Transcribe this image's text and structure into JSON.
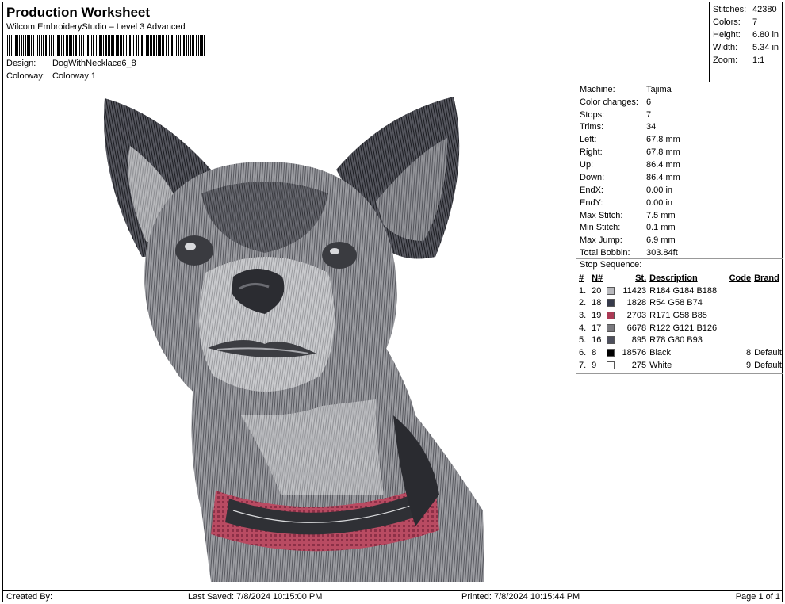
{
  "header": {
    "title": "Production Worksheet",
    "subtitle": "Wilcom EmbroideryStudio – Level 3 Advanced",
    "design_label": "Design:",
    "design_value": "DogWithNecklace6_8",
    "colorway_label": "Colorway:",
    "colorway_value": "Colorway 1"
  },
  "stats": [
    {
      "label": "Stitches:",
      "value": "42380"
    },
    {
      "label": "Colors:",
      "value": "7"
    },
    {
      "label": "Height:",
      "value": "6.80 in"
    },
    {
      "label": "Width:",
      "value": "5.34 in"
    },
    {
      "label": "Zoom:",
      "value": "1:1"
    }
  ],
  "machine_info": [
    {
      "label": "Machine:",
      "value": "Tajima"
    },
    {
      "label": "Color changes:",
      "value": "6"
    },
    {
      "label": "Stops:",
      "value": "7"
    },
    {
      "label": "Trims:",
      "value": "34"
    },
    {
      "label": "Left:",
      "value": "67.8 mm"
    },
    {
      "label": "Right:",
      "value": "67.8 mm"
    },
    {
      "label": "Up:",
      "value": "86.4 mm"
    },
    {
      "label": "Down:",
      "value": "86.4 mm"
    },
    {
      "label": "EndX:",
      "value": "0.00 in"
    },
    {
      "label": "EndY:",
      "value": "0.00 in"
    },
    {
      "label": "Max Stitch:",
      "value": "7.5 mm"
    },
    {
      "label": "Min Stitch:",
      "value": "0.1 mm"
    },
    {
      "label": "Max Jump:",
      "value": "6.9 mm"
    },
    {
      "label": "Total Bobbin:",
      "value": "303.84ft"
    }
  ],
  "stop_sequence": {
    "title": "Stop Sequence:",
    "headers": {
      "idx": "#",
      "n": "N#",
      "st": "St.",
      "desc": "Description",
      "code": "Code",
      "brand": "Brand"
    },
    "rows": [
      {
        "idx": "1.",
        "n": "20",
        "color": "#b8b8bc",
        "st": "11423",
        "desc": "R184 G184 B188",
        "code": "",
        "brand": ""
      },
      {
        "idx": "2.",
        "n": "18",
        "color": "#363a4a",
        "st": "1828",
        "desc": "R54 G58 B74",
        "code": "",
        "brand": ""
      },
      {
        "idx": "3.",
        "n": "19",
        "color": "#ab3a55",
        "st": "2703",
        "desc": "R171 G58 B85",
        "code": "",
        "brand": ""
      },
      {
        "idx": "4.",
        "n": "17",
        "color": "#7a797e",
        "st": "6678",
        "desc": "R122 G121 B126",
        "code": "",
        "brand": ""
      },
      {
        "idx": "5.",
        "n": "16",
        "color": "#4e505d",
        "st": "895",
        "desc": "R78 G80 B93",
        "code": "",
        "brand": ""
      },
      {
        "idx": "6.",
        "n": "8",
        "color": "#000000",
        "st": "18576",
        "desc": "Black",
        "code": "8",
        "brand": "Default"
      },
      {
        "idx": "7.",
        "n": "9",
        "color": "#ffffff",
        "st": "275",
        "desc": "White",
        "code": "9",
        "brand": "Default"
      }
    ]
  },
  "footer": {
    "created_by": "Created By:",
    "last_saved": "Last Saved: 7/8/2024 10:15:00 PM",
    "printed": "Printed: 7/8/2024 10:15:44 PM",
    "page": "Page 1 of 1"
  }
}
